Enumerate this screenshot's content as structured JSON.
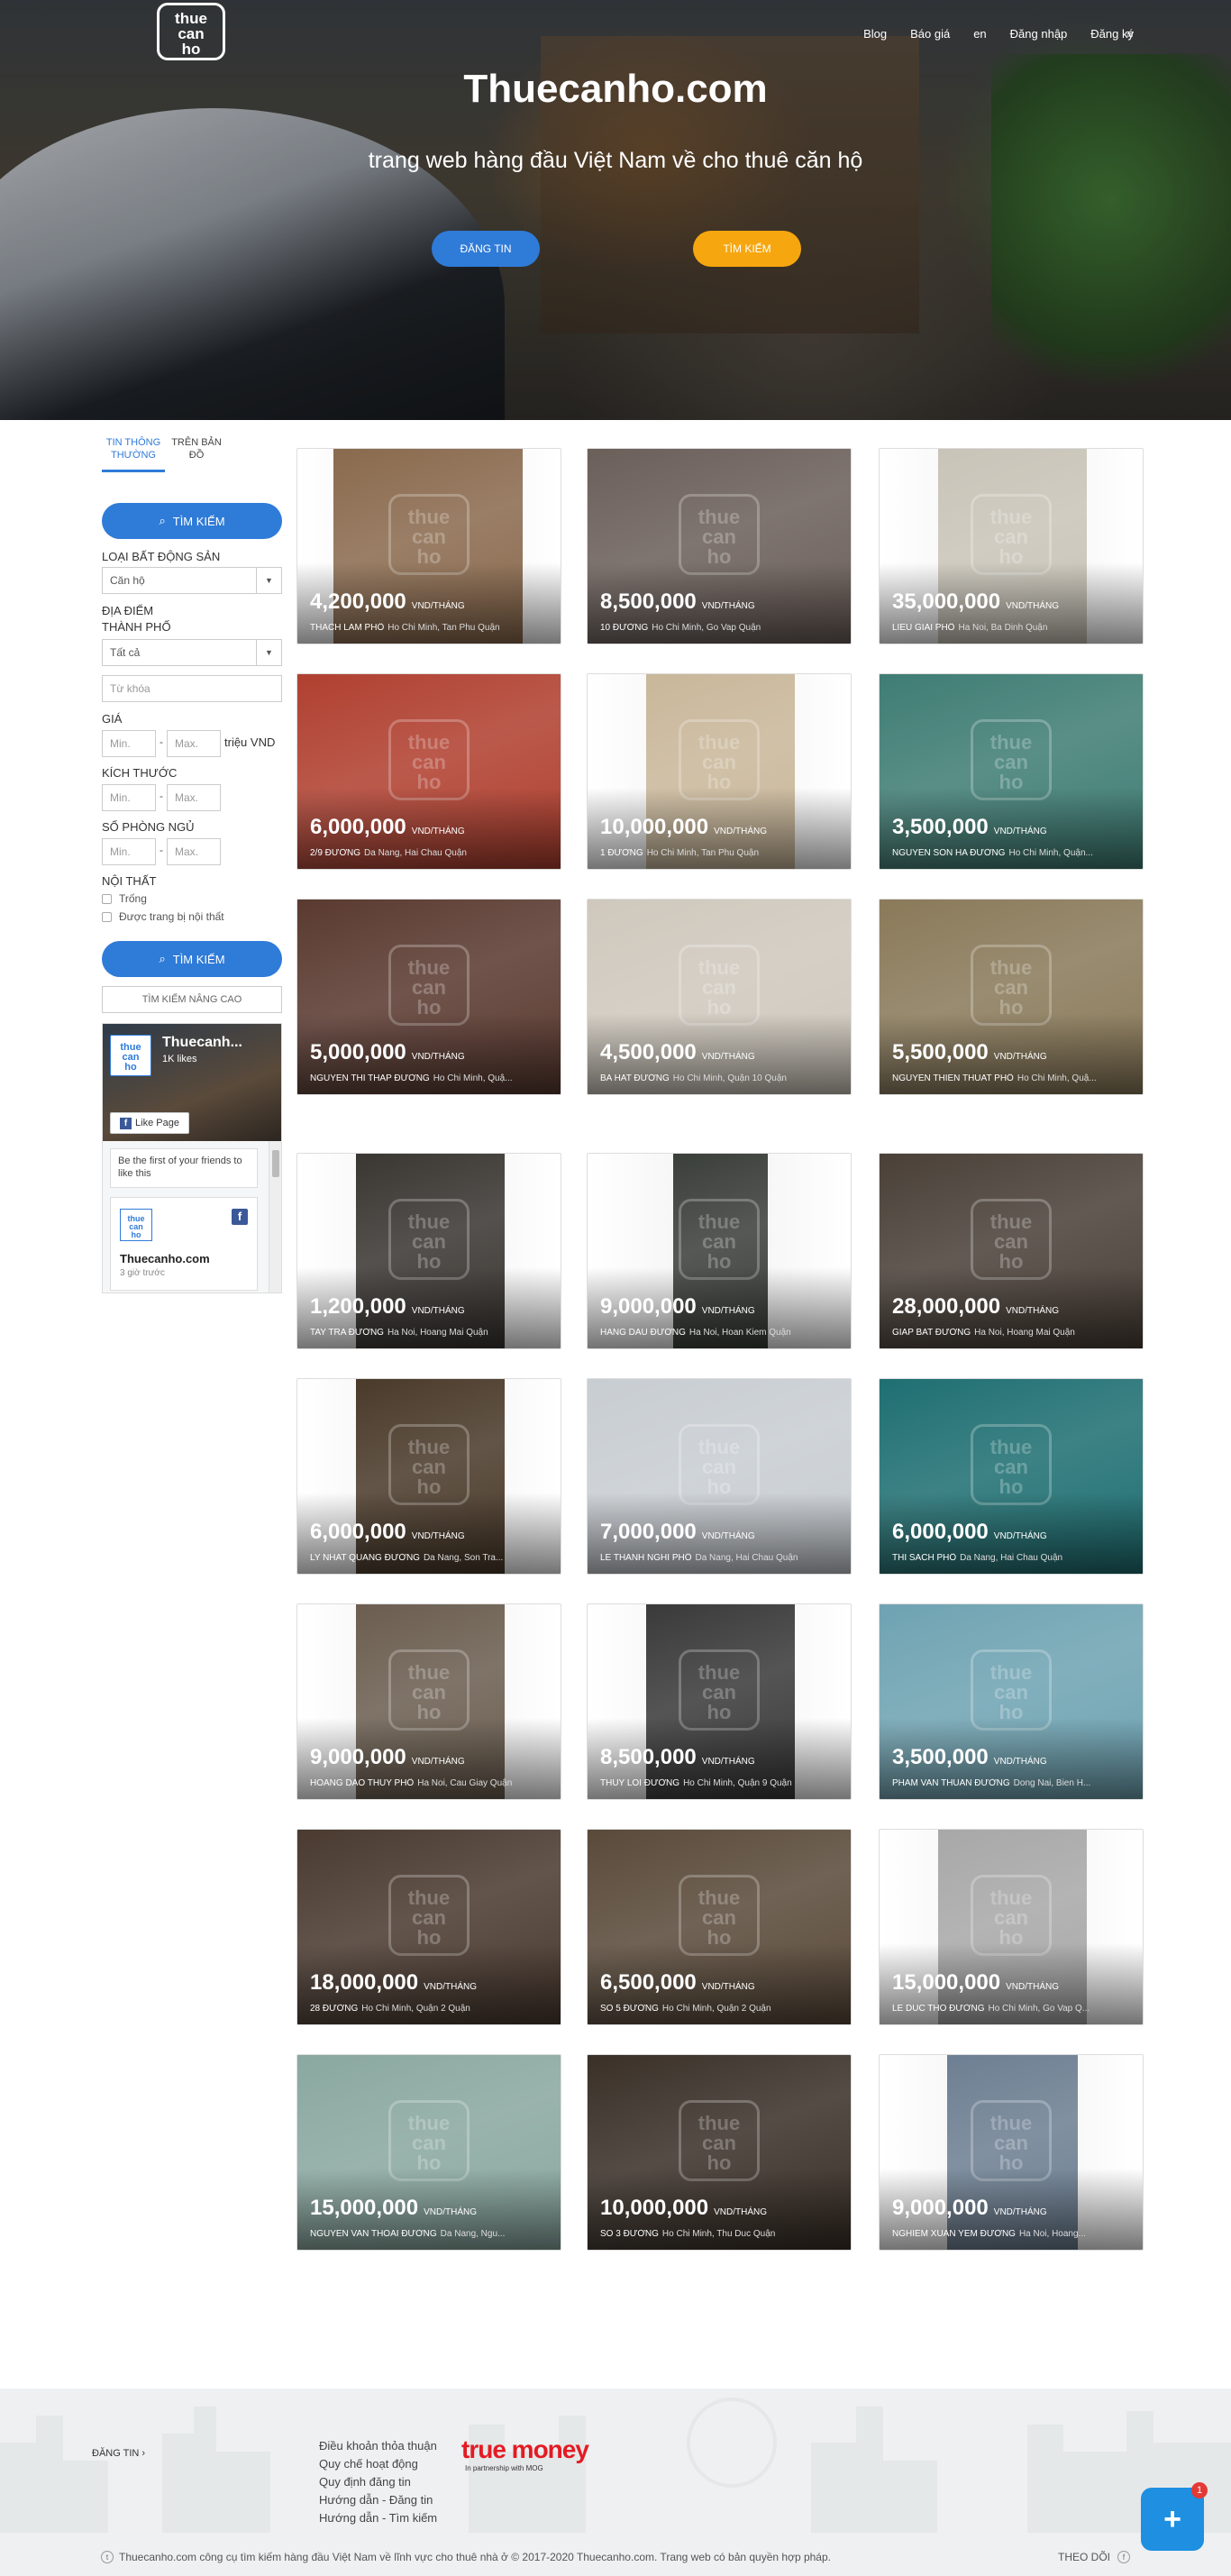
{
  "header": {
    "logo_text": "thue can ho",
    "nav": [
      "Blog",
      "Báo giá",
      "en",
      "Đăng nhập",
      "Đăng ký"
    ],
    "menu_icon": "hamburger-icon"
  },
  "hero": {
    "title": "Thuecanho.com",
    "subtitle": "trang web hàng đầu Việt Nam về cho thuê căn hộ",
    "post_button": "ĐĂNG TIN",
    "search_button": "TÌM KIẾM"
  },
  "sidebar": {
    "tabs": [
      "TIN THÔNG THƯỜNG",
      "TRÊN BẢN ĐỒ"
    ],
    "search_button": "TÌM KIẾM",
    "property_type_label": "LOẠI BẤT ĐỘNG SẢN",
    "property_type_value": "Căn hộ",
    "location_label": "ĐỊA ĐIỂM",
    "city_label": "THÀNH PHỐ",
    "city_value": "Tất cả",
    "keyword_placeholder": "Từ khóa",
    "price_label": "GIÁ",
    "min_placeholder": "Min.",
    "max_placeholder": "Max.",
    "price_unit": "triệu VND",
    "size_label": "KÍCH THƯỚC",
    "rooms_label": "SỐ PHÒNG NGỦ",
    "furniture_label": "NỘI THẤT",
    "furniture_options": [
      "Trống",
      "Được trang bị nội thất"
    ],
    "search_button_2": "TÌM KIẾM",
    "advanced_button": "TÌM KIẾM NÂNG CAO",
    "facebook": {
      "page_name": "Thuecanh...",
      "likes": "1K likes",
      "like_button": "Like Page",
      "first_text": "Be the first of your friends to like this",
      "post_name": "Thuecanho.com",
      "post_time": "3 giờ trước"
    }
  },
  "listings": [
    {
      "price": "4,200,000",
      "unit": "VND/THÁNG",
      "street": "THACH LAM PHỐ",
      "city": "Ho Chi Minh, Tan Phu Quận"
    },
    {
      "price": "8,500,000",
      "unit": "VND/THÁNG",
      "street": "10 ĐƯỜNG",
      "city": "Ho Chi Minh, Go Vap Quận"
    },
    {
      "price": "35,000,000",
      "unit": "VND/THÁNG",
      "street": "LIEU GIAI PHỐ",
      "city": "Ha Noi, Ba Dinh Quận"
    },
    {
      "price": "6,000,000",
      "unit": "VND/THÁNG",
      "street": "2/9 ĐƯỜNG",
      "city": "Da Nang, Hai Chau Quận"
    },
    {
      "price": "10,000,000",
      "unit": "VND/THÁNG",
      "street": "1 ĐƯỜNG",
      "city": "Ho Chi Minh, Tan Phu Quận"
    },
    {
      "price": "3,500,000",
      "unit": "VND/THÁNG",
      "street": "NGUYEN SON HA ĐƯỜNG",
      "city": "Ho Chi Minh, Quận..."
    },
    {
      "price": "5,000,000",
      "unit": "VND/THÁNG",
      "street": "NGUYEN THI THAP ĐƯỜNG",
      "city": "Ho Chi Minh, Quậ..."
    },
    {
      "price": "4,500,000",
      "unit": "VND/THÁNG",
      "street": "BA HAT ĐƯỜNG",
      "city": "Ho Chi Minh, Quận 10 Quận"
    },
    {
      "price": "5,500,000",
      "unit": "VND/THÁNG",
      "street": "NGUYEN THIEN THUAT PHỐ",
      "city": "Ho Chi Minh, Quậ..."
    },
    {
      "price": "1,200,000",
      "unit": "VND/THÁNG",
      "street": "TAY TRA ĐƯỜNG",
      "city": "Ha Noi, Hoang Mai Quận"
    },
    {
      "price": "9,000,000",
      "unit": "VND/THÁNG",
      "street": "HANG DAU ĐƯỜNG",
      "city": "Ha Noi, Hoan Kiem Quận"
    },
    {
      "price": "28,000,000",
      "unit": "VND/THÁNG",
      "street": "GIAP BAT ĐƯỜNG",
      "city": "Ha Noi, Hoang Mai Quận"
    },
    {
      "price": "6,000,000",
      "unit": "VND/THÁNG",
      "street": "LY NHAT QUANG ĐƯỜNG",
      "city": "Da Nang, Son Tra..."
    },
    {
      "price": "7,000,000",
      "unit": "VND/THÁNG",
      "street": "LE THANH NGHI PHỐ",
      "city": "Da Nang, Hai Chau Quận"
    },
    {
      "price": "6,000,000",
      "unit": "VND/THÁNG",
      "street": "THI SACH PHỐ",
      "city": "Da Nang, Hai Chau Quận"
    },
    {
      "price": "9,000,000",
      "unit": "VND/THÁNG",
      "street": "HOANG DAO THUY PHỐ",
      "city": "Ha Noi, Cau Giay Quận"
    },
    {
      "price": "8,500,000",
      "unit": "VND/THÁNG",
      "street": "THUY LOI ĐƯỜNG",
      "city": "Ho Chi Minh, Quận 9 Quận"
    },
    {
      "price": "3,500,000",
      "unit": "VND/THÁNG",
      "street": "PHAM VAN THUAN ĐƯỜNG",
      "city": "Dong Nai, Bien H..."
    },
    {
      "price": "18,000,000",
      "unit": "VND/THÁNG",
      "street": "28 ĐƯỜNG",
      "city": "Ho Chi Minh, Quận 2 Quận"
    },
    {
      "price": "6,500,000",
      "unit": "VND/THÁNG",
      "street": "SO 5 ĐƯỜNG",
      "city": "Ho Chi Minh, Quận 2 Quận"
    },
    {
      "price": "15,000,000",
      "unit": "VND/THÁNG",
      "street": "LE DUC THO ĐƯỜNG",
      "city": "Ho Chi Minh, Go Vap Q..."
    },
    {
      "price": "15,000,000",
      "unit": "VND/THÁNG",
      "street": "NGUYEN VAN THOAI ĐƯỜNG",
      "city": "Da Nang, Ngu..."
    },
    {
      "price": "10,000,000",
      "unit": "VND/THÁNG",
      "street": "SO 3 ĐƯỜNG",
      "city": "Ho Chi Minh, Thu Duc Quận"
    },
    {
      "price": "9,000,000",
      "unit": "VND/THÁNG",
      "street": "NGHIEM XUAN YEM ĐƯỜNG",
      "city": "Ha Noi, Hoang..."
    }
  ],
  "photo_colors": [
    "#8a6a4e",
    "#6b5f5a",
    "#c9c4b8",
    "#b04030",
    "#c9b79a",
    "#3f7d74",
    "#5a3a30",
    "#cfc8bd",
    "#8a7a5a",
    "#3a3632",
    "#3b3f3a",
    "#4a4038",
    "#4a3a2a",
    "#c8cdd2",
    "#1f6f72",
    "#6b5e50",
    "#3a3a3a",
    "#6fa3b2",
    "#4a3a30",
    "#5a4a3a",
    "#a8a8a8",
    "#8aa8a0",
    "#3a3028",
    "#6d7f92"
  ],
  "footer": {
    "post_link": "ĐĂNG TIN ›",
    "links": [
      "Điều khoản thỏa thuận",
      "Quy chế hoạt động",
      "Quy định đăng tin",
      "Hướng dẫn - Đăng tin",
      "Hướng dẫn - Tìm kiếm"
    ],
    "partner": "true money",
    "partner_sub": "In partnership with MOG",
    "copyright": "Thuecanho.com công cụ tìm kiếm hàng đầu Việt Nam về lĩnh vực cho thuê nhà ở © 2017-2020 Thuecanho.com. Trang web có bản quyền hợp pháp.",
    "follow": "THEO DÕI",
    "chat_badge": "1"
  }
}
